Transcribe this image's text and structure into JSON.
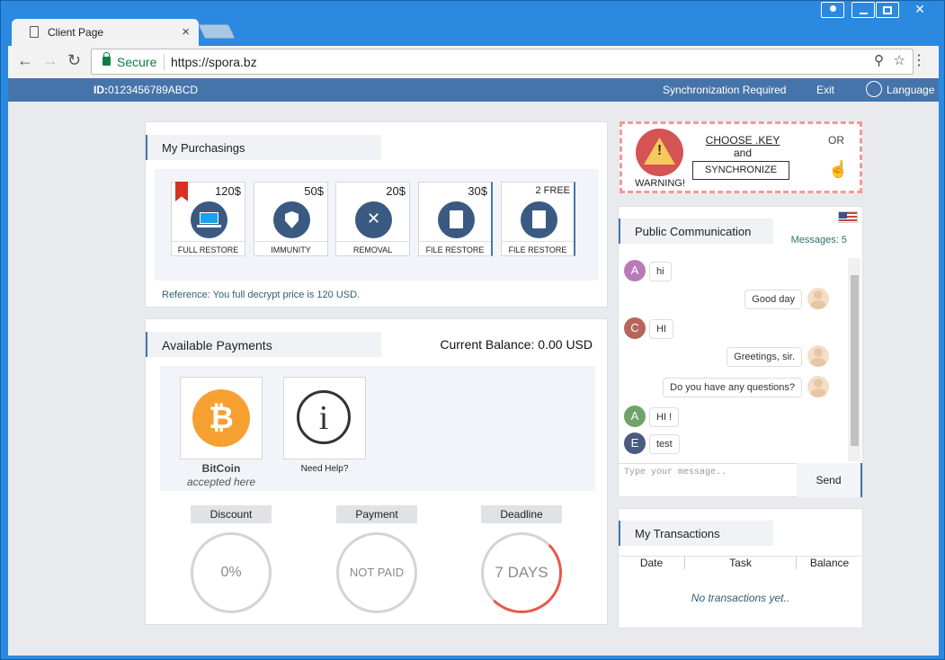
{
  "browser": {
    "tab_title": "Client Page",
    "secure_label": "Secure",
    "url": "https://spora.bz"
  },
  "topbar": {
    "id_label": "ID:",
    "id_value": "0123456789ABCD",
    "sync_required": "Synchronization Required",
    "exit": "Exit",
    "language": "Language"
  },
  "purchasings": {
    "title": "My Purchasings",
    "items": [
      {
        "price": "120$",
        "label": "FULL RESTORE",
        "icon": "laptop-icon"
      },
      {
        "price": "50$",
        "label": "IMMUNITY",
        "icon": "shield-icon"
      },
      {
        "price": "20$",
        "label": "REMOVAL",
        "icon": "tools-icon"
      },
      {
        "price": "30$",
        "label": "FILE RESTORE",
        "icon": "file-icon"
      },
      {
        "price": "2 FREE",
        "label": "FILE RESTORE",
        "icon": "file-icon"
      }
    ],
    "reference": "Reference: You full decrypt price is 120 USD."
  },
  "payments": {
    "title": "Available Payments",
    "balance": "Current Balance: 0.00 USD",
    "bitcoin_name": "BitCoin",
    "bitcoin_sub": "accepted here",
    "help": "Need Help?",
    "gauges": [
      {
        "label": "Discount",
        "value": "0%",
        "progress": 0
      },
      {
        "label": "Payment",
        "value": "NOT PAID",
        "progress": 0
      },
      {
        "label": "Deadline",
        "value": "7 DAYS",
        "progress": 0.5
      }
    ]
  },
  "warning": {
    "label": "WARNING!",
    "choose_key": "CHOOSE .KEY",
    "and": "and",
    "synchronize": "SYNCHRONIZE",
    "or": "OR"
  },
  "chat": {
    "title": "Public Communication",
    "messages_count": "Messages: 5",
    "placeholder": "Type your message..",
    "send": "Send",
    "messages": [
      {
        "side": "left",
        "avatar": "A",
        "color": "#b87bb8",
        "text": "hi"
      },
      {
        "side": "right",
        "text": "Good day"
      },
      {
        "side": "left",
        "avatar": "C",
        "color": "#b6665a",
        "text": "HI"
      },
      {
        "side": "right",
        "text": "Greetings, sir."
      },
      {
        "side": "right",
        "text": "Do you have any questions?"
      },
      {
        "side": "left",
        "avatar": "A",
        "color": "#6fa36a",
        "text": "HI !"
      },
      {
        "side": "left",
        "avatar": "E",
        "color": "#4a5a80",
        "text": "test"
      }
    ]
  },
  "transactions": {
    "title": "My Transactions",
    "columns": [
      "Date",
      "Task",
      "Balance"
    ],
    "empty": "No transactions yet.."
  }
}
